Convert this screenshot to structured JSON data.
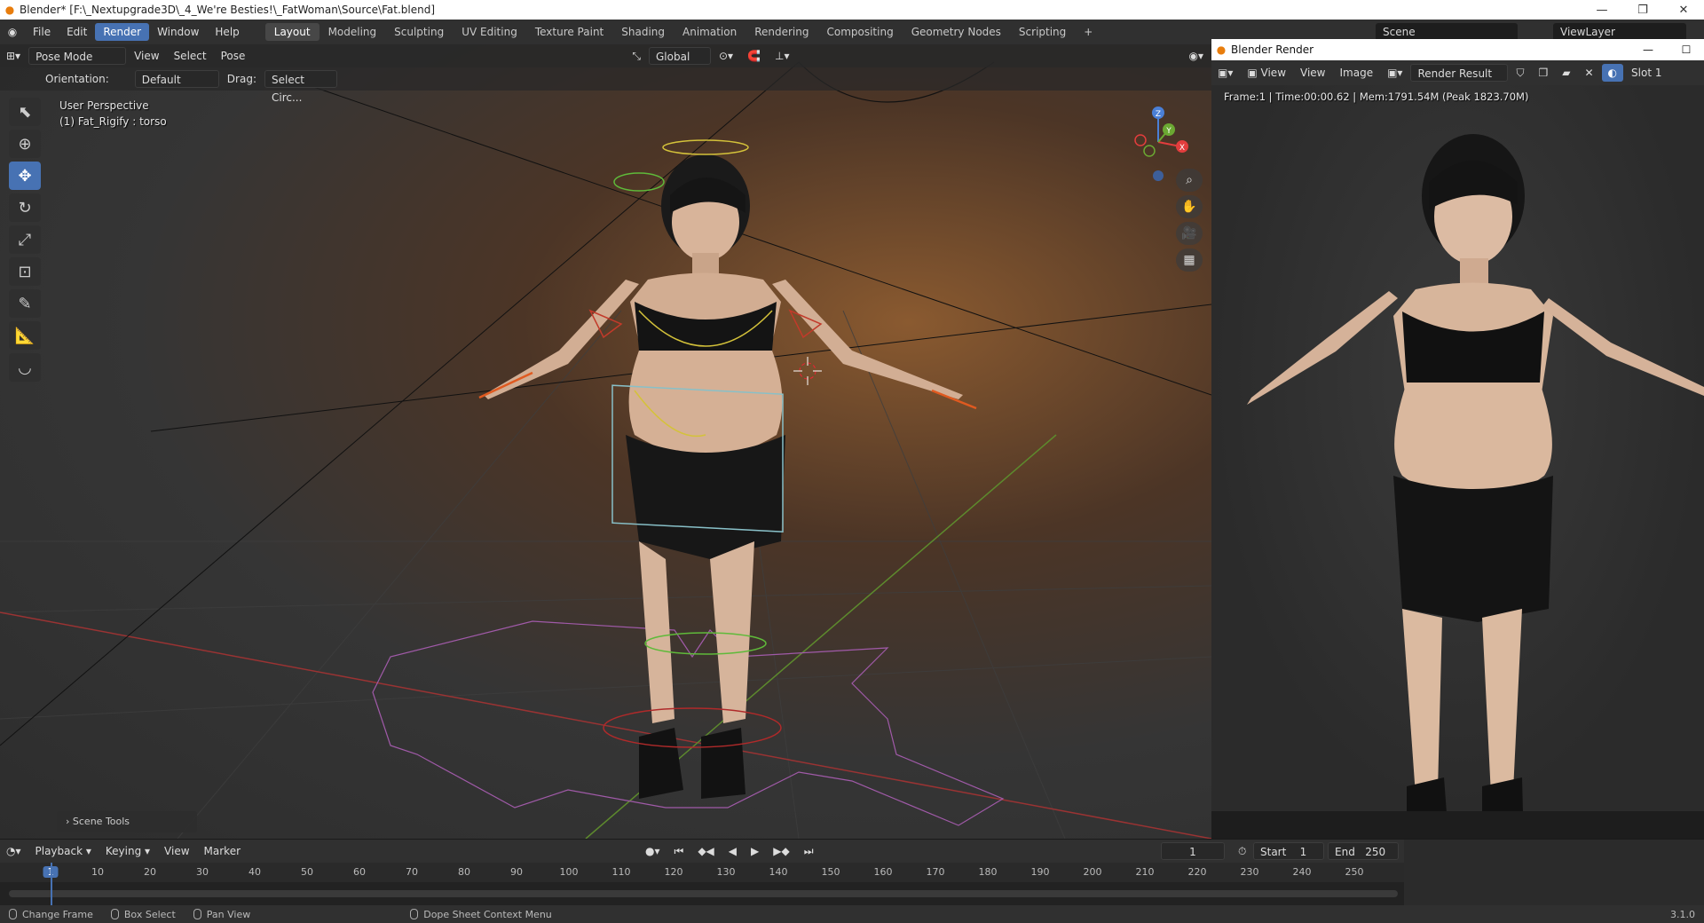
{
  "window": {
    "title": "Blender* [F:\\_Nextupgrade3D\\_4_We're Besties!\\_FatWoman\\Source\\Fat.blend]",
    "controls": [
      "—",
      "❐",
      "✕"
    ]
  },
  "menu": [
    "File",
    "Edit",
    "Render",
    "Window",
    "Help"
  ],
  "menu_active": "Render",
  "workspaces": [
    "Layout",
    "Modeling",
    "Sculpting",
    "UV Editing",
    "Texture Paint",
    "Shading",
    "Animation",
    "Rendering",
    "Compositing",
    "Geometry Nodes",
    "Scripting",
    "+"
  ],
  "workspace_active": "Layout",
  "scene": {
    "label": "Scene",
    "viewlayer": "ViewLayer"
  },
  "viewport": {
    "mode": "Pose Mode",
    "header_menus": [
      "View",
      "Select",
      "Pose"
    ],
    "transform_orientation": "Global",
    "tool_settings": {
      "orientation_label": "Orientation:",
      "orientation_value": "Default",
      "drag_label": "Drag:",
      "drag_value": "Select Circ..."
    },
    "info_line1": "User Perspective",
    "info_line2": "(1) Fat_Rigify : torso",
    "scene_tools": "Scene Tools",
    "gizmo_axes": {
      "x": "X",
      "y": "Y",
      "z": "Z"
    }
  },
  "render_window": {
    "title": "Blender Render",
    "menus": [
      "View",
      "View",
      "Image"
    ],
    "image_name": "Render Result",
    "slot": "Slot 1",
    "stats": "Frame:1 | Time:00:00.62 | Mem:1791.54M (Peak 1823.70M)"
  },
  "timeline": {
    "menus": [
      "Playback",
      "Keying",
      "View",
      "Marker"
    ],
    "current_frame": "1",
    "start_label": "Start",
    "start": "1",
    "end_label": "End",
    "end": "250",
    "ticks": [
      "1",
      "10",
      "20",
      "30",
      "40",
      "50",
      "60",
      "70",
      "80",
      "90",
      "100",
      "110",
      "120",
      "130",
      "140",
      "150",
      "160",
      "170",
      "180",
      "190",
      "200",
      "210",
      "220",
      "230",
      "240",
      "250"
    ]
  },
  "statusbar": {
    "items": [
      "Change Frame",
      "Box Select",
      "Pan View",
      "Dope Sheet Context Menu"
    ],
    "version": "3.1.0"
  }
}
